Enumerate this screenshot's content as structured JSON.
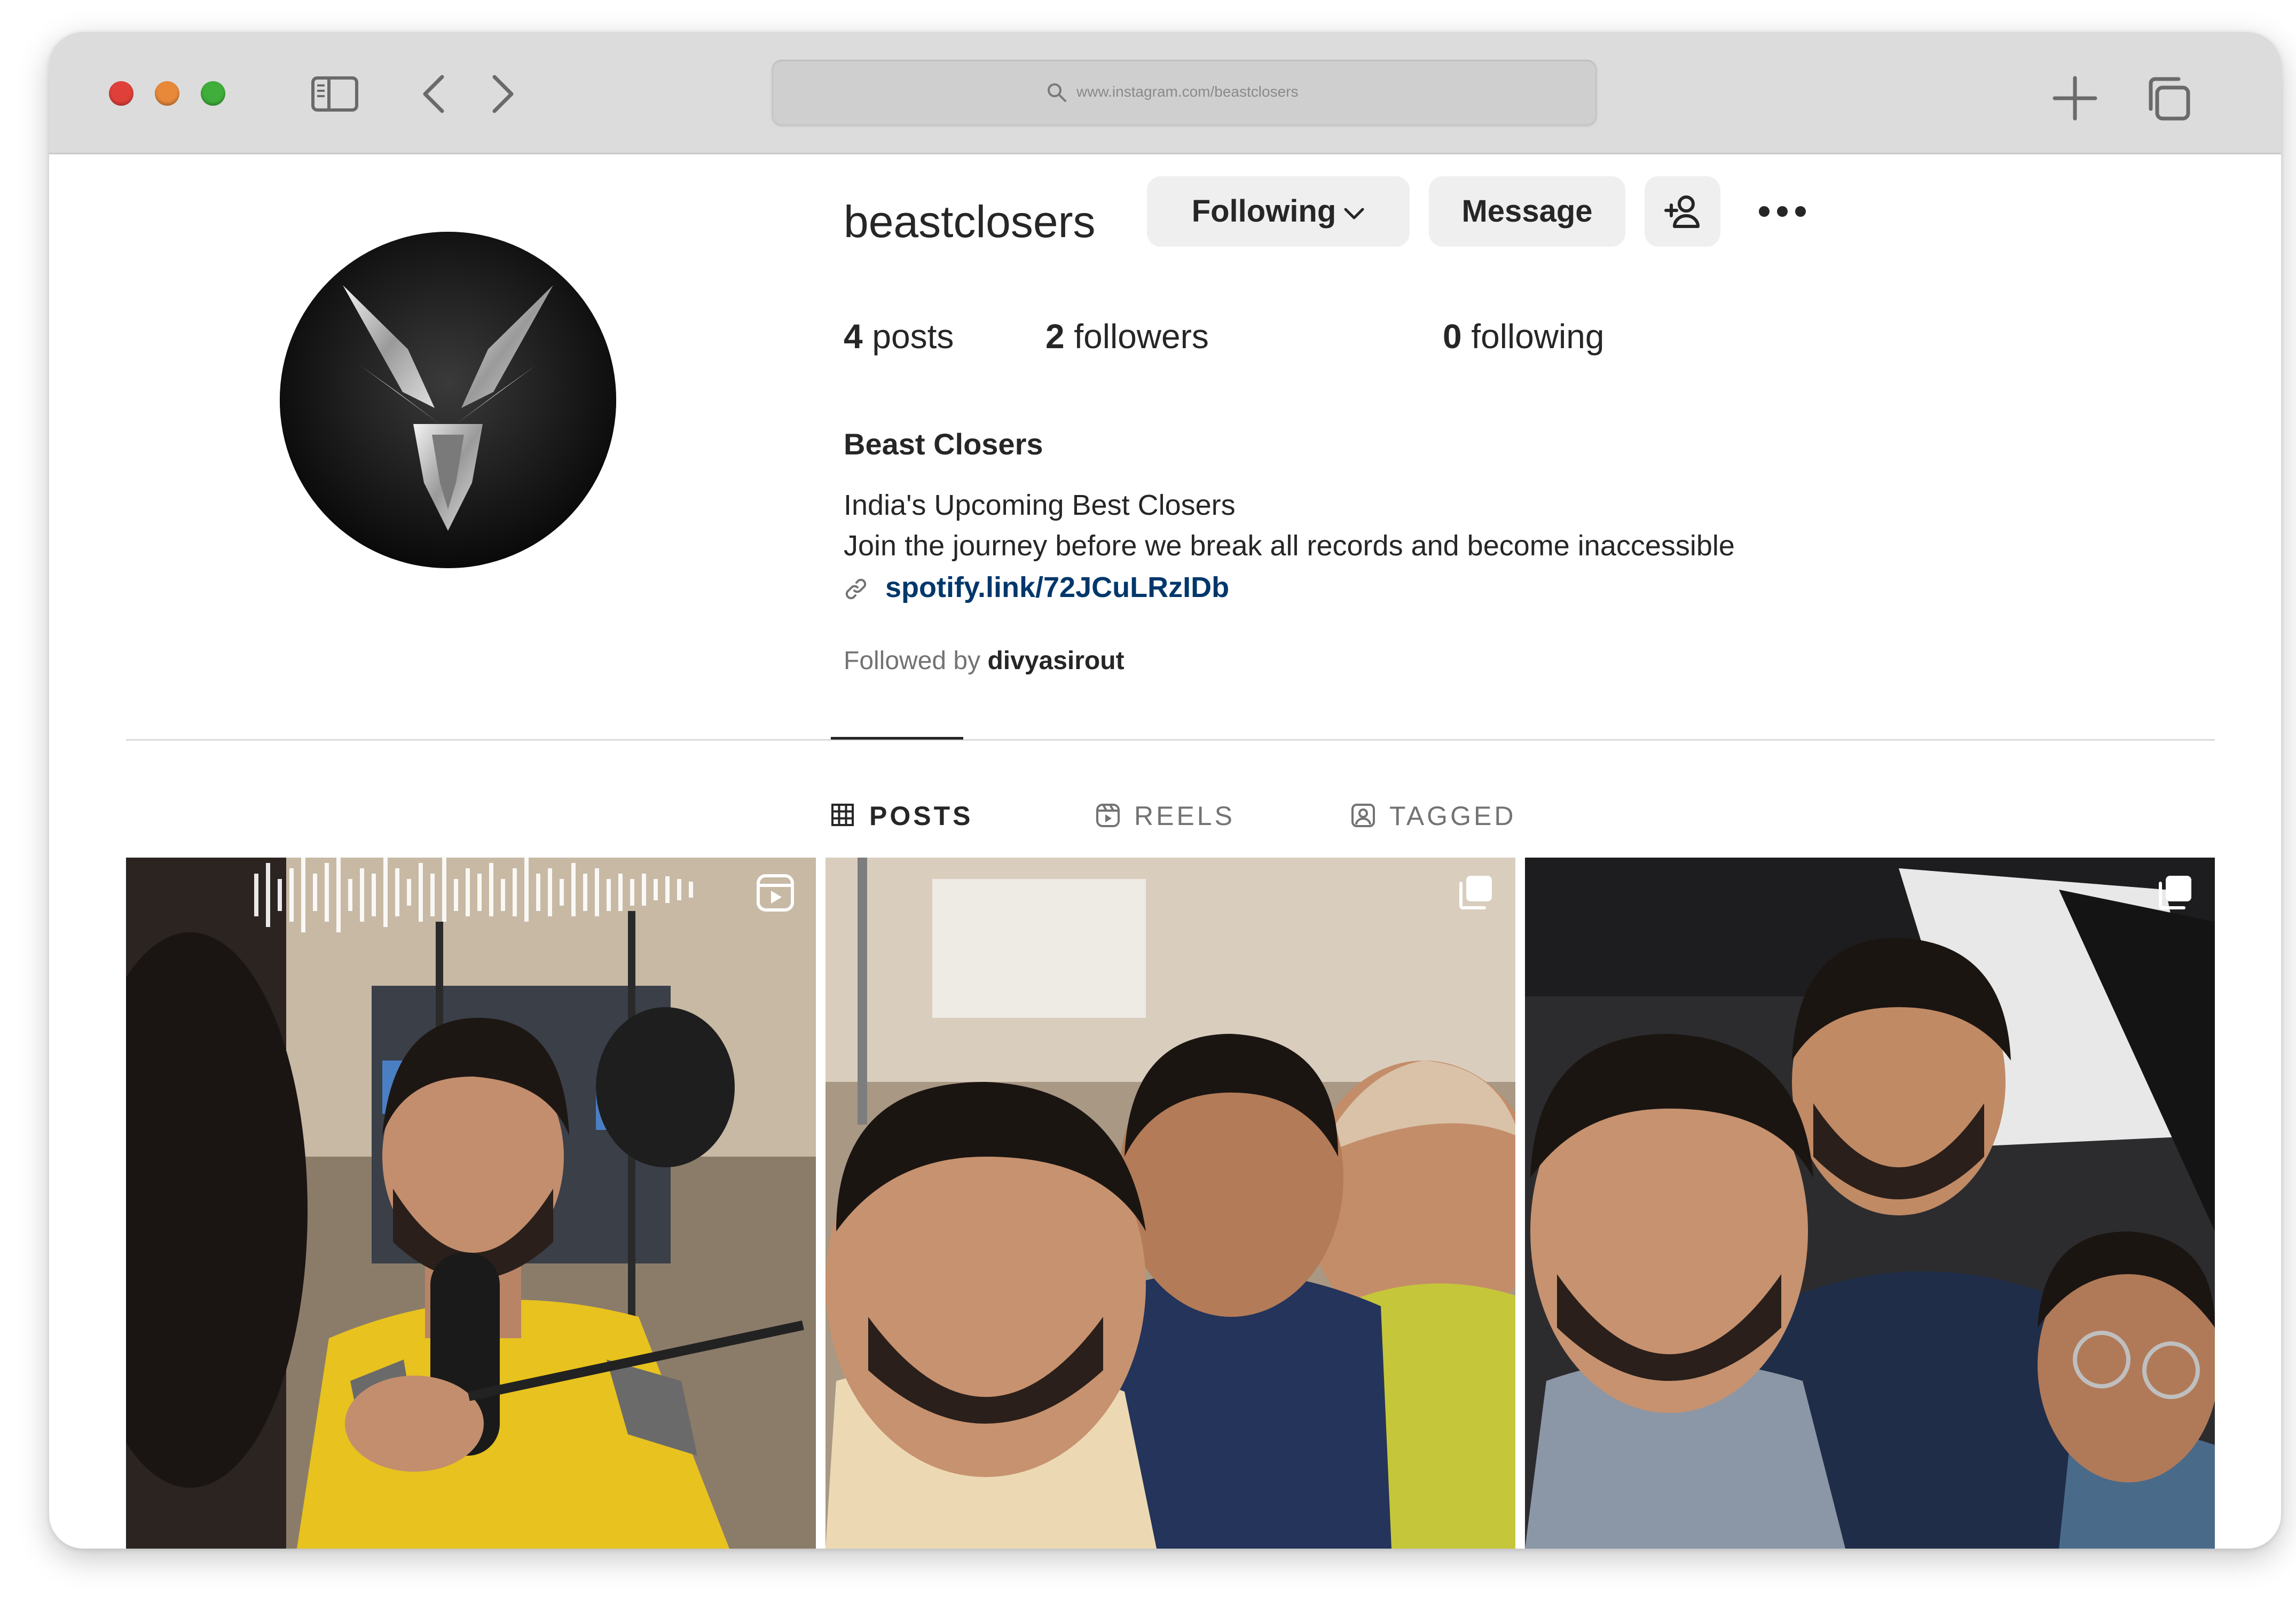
{
  "browser": {
    "url": "www.instagram.com/beastclosers",
    "traffic_lights": {
      "close": "#e0403a",
      "minimize": "#e8893a",
      "zoom": "#3fae3a"
    },
    "icons": [
      "sidebar-icon",
      "back-icon",
      "forward-icon",
      "search-icon",
      "new-tab-icon",
      "tabs-overview-icon"
    ]
  },
  "profile": {
    "username": "beastclosers",
    "buttons": {
      "following": "Following",
      "message": "Message"
    },
    "stats": {
      "posts_count": "4",
      "posts_label": "posts",
      "followers_count": "2",
      "followers_label": "followers",
      "following_count": "0",
      "following_label": "following"
    },
    "full_name": "Beast Closers",
    "bio_line1": "India's Upcoming Best Closers",
    "bio_line2": "Join the journey before we break all records and become inaccessible",
    "link": "spotify.link/72JCuLRzIDb",
    "followed_by_prefix": "Followed by",
    "followed_by_user": "divyasirout"
  },
  "tabs": [
    {
      "label": "POSTS",
      "icon": "grid-icon",
      "active": true
    },
    {
      "label": "REELS",
      "icon": "reels-icon",
      "active": false
    },
    {
      "label": "TAGGED",
      "icon": "tagged-icon",
      "active": false
    }
  ],
  "posts": [
    {
      "type": "reel",
      "icon": "reel-icon"
    },
    {
      "type": "carousel",
      "icon": "carousel-icon"
    },
    {
      "type": "carousel",
      "icon": "carousel-icon"
    }
  ],
  "colors": {
    "link": "#00376b",
    "text": "#262626",
    "muted": "#737373",
    "button_bg": "#efefef"
  }
}
